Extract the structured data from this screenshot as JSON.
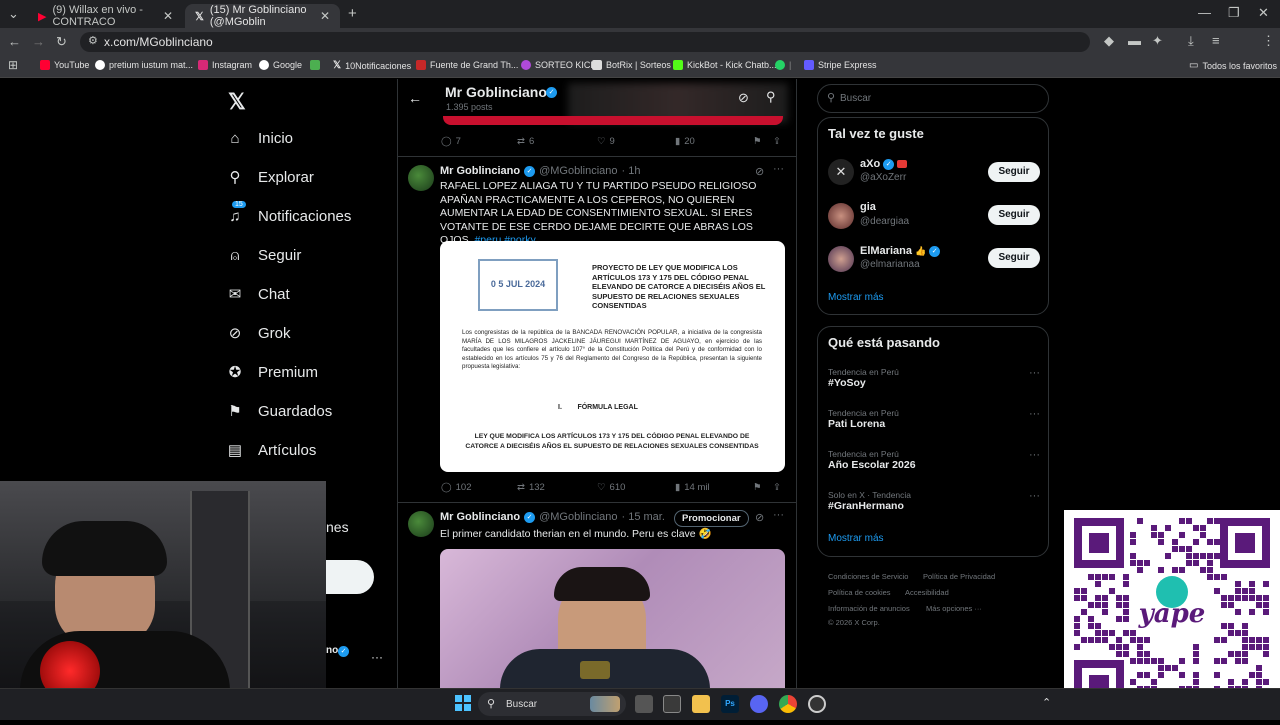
{
  "browser": {
    "tabs": [
      {
        "label": "(9) Willax en vivo - CONTRACO",
        "icon": "youtube-icon",
        "active": false
      },
      {
        "label": "(15) Mr Goblinciano (@MGoblin",
        "icon": "x-icon",
        "active": true
      }
    ],
    "new_tab": "+",
    "url": "x.com/MGoblinciano",
    "bookmarks": [
      "YouTube",
      "pretium iustum mat...",
      "Instagram",
      "Google",
      "10Notificaciones",
      "Fuente de Grand Th...",
      "SORTEO KICK",
      "BotRix | Sorteos",
      "KickBot - Kick Chatb...",
      "Stripe Express"
    ],
    "all_bookmarks": "Todos los favoritos"
  },
  "nav": {
    "items": [
      {
        "label": "Inicio",
        "icon": "home-icon"
      },
      {
        "label": "Explorar",
        "icon": "search-icon"
      },
      {
        "label": "Notificaciones",
        "icon": "bell-icon",
        "badge": "15"
      },
      {
        "label": "Seguir",
        "icon": "person-plus-icon"
      },
      {
        "label": "Chat",
        "icon": "mail-icon"
      },
      {
        "label": "Grok",
        "icon": "grok-icon"
      },
      {
        "label": "Premium",
        "icon": "verified-icon"
      },
      {
        "label": "Guardados",
        "icon": "bookmark-icon"
      },
      {
        "label": "Artículos",
        "icon": "articles-icon"
      }
    ],
    "more_fragment": "nes",
    "profile_fragment": "no"
  },
  "profile": {
    "name": "Mr Goblinciano",
    "posts": "1.395 posts",
    "top_actions": {
      "reply": "7",
      "repost": "6",
      "like": "9",
      "views": "20"
    }
  },
  "tweets": [
    {
      "name": "Mr Goblinciano",
      "handle": "@MGoblinciano",
      "time": "· 1h",
      "text": "RAFAEL LOPEZ ALIAGA TU Y TU PARTIDO PSEUDO RELIGIOSO APAÑAN PRACTICAMENTE A LOS CEPEROS, NO QUIEREN AUMENTAR LA EDAD DE CONSENTIMIENTO SEXUAL. SI ERES VOTANTE DE ESE CERDO DEJAME DECIRTE QUE ABRAS LOS OJOS.",
      "hashtags": [
        "#peru",
        "#porky"
      ],
      "doc": {
        "stamp_date": "0 5 JUL 2024",
        "heading": "PROYECTO DE LEY QUE MODIFICA LOS ARTÍCULOS 173 Y 175 DEL CÓDIGO PENAL ELEVANDO DE CATORCE A DIECISÉIS AÑOS EL SUPUESTO DE RELACIONES SEXUALES CONSENTIDAS",
        "body": "Los congresistas de la república de la BANCADA RENOVACIÓN POPULAR, a iniciativa de la congresista MARÍA DE LOS MILAGROS JACKELINE JÁUREGUI MARTÍNEZ DE AGUAYO, en ejercicio de las facultades que les confiere el artículo 107° de la Constitución Política del Perú y de conformidad con lo establecido en los artículos 75 y 76 del Reglamento del Congreso de la República, presentan la siguiente propuesta legislativa:",
        "section": "I.        FÓRMULA LEGAL",
        "law_title": "LEY QUE MODIFICA LOS ARTÍCULOS 173 Y 175 DEL CÓDIGO PENAL ELEVANDO DE CATORCE A DIECISÉIS AÑOS EL SUPUESTO DE RELACIONES SEXUALES CONSENTIDAS"
      },
      "actions": {
        "reply": "102",
        "repost": "132",
        "like": "610",
        "views": "14 mil"
      }
    },
    {
      "name": "Mr Goblinciano",
      "handle": "@MGoblinciano",
      "time": "· 15 mar.",
      "promote": "Promocionar",
      "text": "El primer candidato therian en el mundo. Peru es clave 🤣"
    }
  ],
  "right": {
    "search_placeholder": "Buscar",
    "who_to_follow": {
      "title": "Tal vez te guste",
      "users": [
        {
          "name": "aXo",
          "handle": "@aXoZerr",
          "button": "Seguir"
        },
        {
          "name": "gia",
          "handle": "@deargiaa",
          "button": "Seguir"
        },
        {
          "name": "ElMariana",
          "handle": "@elmarianaa",
          "button": "Seguir"
        }
      ],
      "more": "Mostrar más"
    },
    "trends": {
      "title": "Qué está pasando",
      "items": [
        {
          "category": "Tendencia en Perú",
          "name": "#YoSoy"
        },
        {
          "category": "Tendencia en Perú",
          "name": "Pati Lorena"
        },
        {
          "category": "Tendencia en Perú",
          "name": "Año Escolar 2026"
        },
        {
          "category": "Solo en X · Tendencia",
          "name": "#GranHermano"
        }
      ],
      "more": "Mostrar más"
    },
    "footer": [
      "Condiciones de Servicio",
      "Política de Privacidad",
      "Política de cookies",
      "Accesibilidad",
      "Información de anuncios",
      "Más opciones ···",
      "© 2026 X Corp."
    ]
  },
  "taskbar": {
    "search": "Buscar"
  },
  "colors": {
    "accent": "#1d9bf0",
    "bg": "#000000",
    "border": "#2f3336",
    "muted": "#71767b",
    "yape": "#5a1a7a"
  }
}
